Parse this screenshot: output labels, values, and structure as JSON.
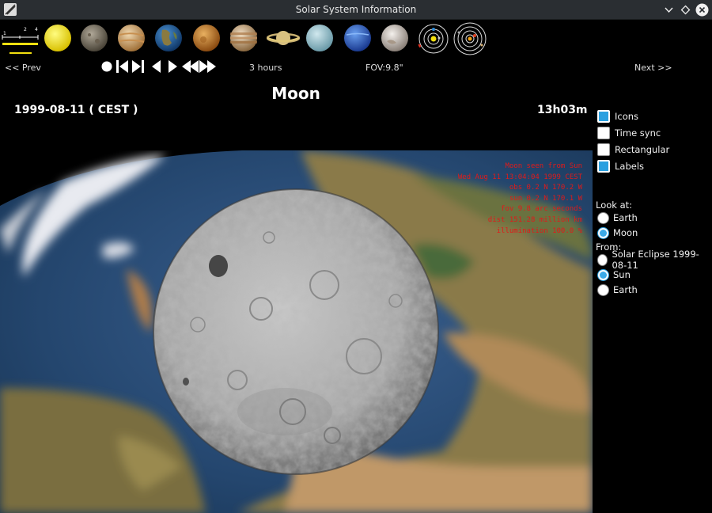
{
  "window": {
    "title": "Solar System Information"
  },
  "toolbar": {
    "scale_ticks": [
      "1",
      "2",
      "4"
    ],
    "planets": [
      {
        "name": "sun-icon",
        "color": "#f3e010"
      },
      {
        "name": "mercury-icon",
        "color": "#8a8070"
      },
      {
        "name": "venus-icon",
        "color": "#d8b070"
      },
      {
        "name": "earth-icon",
        "color": "#2a6aa8"
      },
      {
        "name": "mars-icon",
        "color": "#c88430"
      },
      {
        "name": "jupiter-icon",
        "color": "#c8a070"
      },
      {
        "name": "saturn-icon",
        "color": "#d8c080"
      },
      {
        "name": "uranus-icon",
        "color": "#a8c8d0"
      },
      {
        "name": "neptune-icon",
        "color": "#3a70c8"
      },
      {
        "name": "pluto-icon",
        "color": "#d8d4d0"
      },
      {
        "name": "inner-orbits-icon",
        "color": "#000000"
      },
      {
        "name": "outer-orbits-icon",
        "color": "#000000"
      }
    ]
  },
  "nav": {
    "prev_label": "<<  Prev",
    "next_label": "Next  >>",
    "time_step": "3 hours",
    "fov": "FOV:9.8\""
  },
  "header": {
    "body_name": "Moon",
    "date": "1999-08-11   ( CEST )",
    "time": "13h03m"
  },
  "overlay": {
    "lines": [
      "Moon seen from Sun",
      "Wed Aug 11 13:04:04 1999 CEST",
      "obs  0.2 N 170.2 W",
      "sun  0.2 N 170.1 W",
      "fov 9.8 arc seconds",
      "dist 151.28 million km",
      "illumination 100.0 %"
    ]
  },
  "panel": {
    "checkboxes": [
      {
        "label": "Icons",
        "checked": true
      },
      {
        "label": "Time sync",
        "checked": false
      },
      {
        "label": "Rectangular",
        "checked": false
      },
      {
        "label": "Labels",
        "checked": true
      }
    ],
    "look_at_label": "Look at:",
    "look_at": [
      {
        "label": "Earth",
        "checked": false
      },
      {
        "label": "Moon",
        "checked": true
      }
    ],
    "from_label": "From:",
    "from": [
      {
        "label": "Solar Eclipse 1999-08-11",
        "checked": false
      },
      {
        "label": "Sun",
        "checked": true
      },
      {
        "label": "Earth",
        "checked": false
      }
    ]
  },
  "colors": {
    "accent": "#2aa0e0",
    "overlay_text": "#e01a1a"
  }
}
